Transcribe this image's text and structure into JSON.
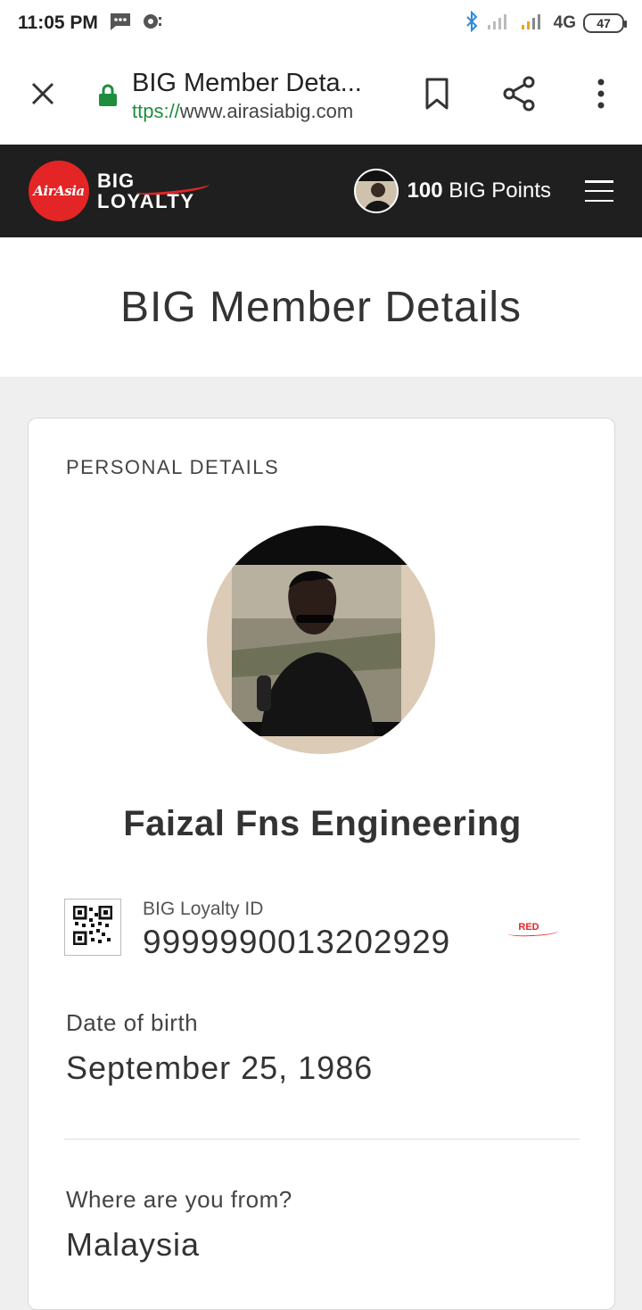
{
  "status_bar": {
    "time": "11:05 PM",
    "network": "4G",
    "battery": "47"
  },
  "browser": {
    "page_title": "BIG Member Deta...",
    "url_scheme": "ttps://",
    "url_host": "www.airasiabig.com"
  },
  "site_header": {
    "logo_airasia": "AirAsia",
    "logo_big": "BIG",
    "logo_loyalty": "LOYALTY",
    "points_value": "100",
    "points_label": "BIG Points"
  },
  "page": {
    "heading": "BIG Member Details"
  },
  "profile": {
    "section_label": "PERSONAL DETAILS",
    "name": "Faizal Fns Engineering",
    "loyalty_id_label": "BIG Loyalty ID",
    "loyalty_id": "9999990013202929",
    "tier": "RED",
    "dob_label": "Date of birth",
    "dob_value": "September 25, 1986",
    "from_label": "Where are you from?",
    "from_value": "Malaysia"
  },
  "colors": {
    "brand_red": "#e32526",
    "header_bg": "#1f1f1f",
    "secure_green": "#1e8e3e"
  },
  "icons": [
    "chat-icon",
    "notification-icon",
    "bluetooth-icon",
    "signal-icon",
    "close-icon",
    "lock-icon",
    "bookmark-icon",
    "share-icon",
    "more-vert-icon",
    "menu-icon",
    "qr-code-icon"
  ]
}
